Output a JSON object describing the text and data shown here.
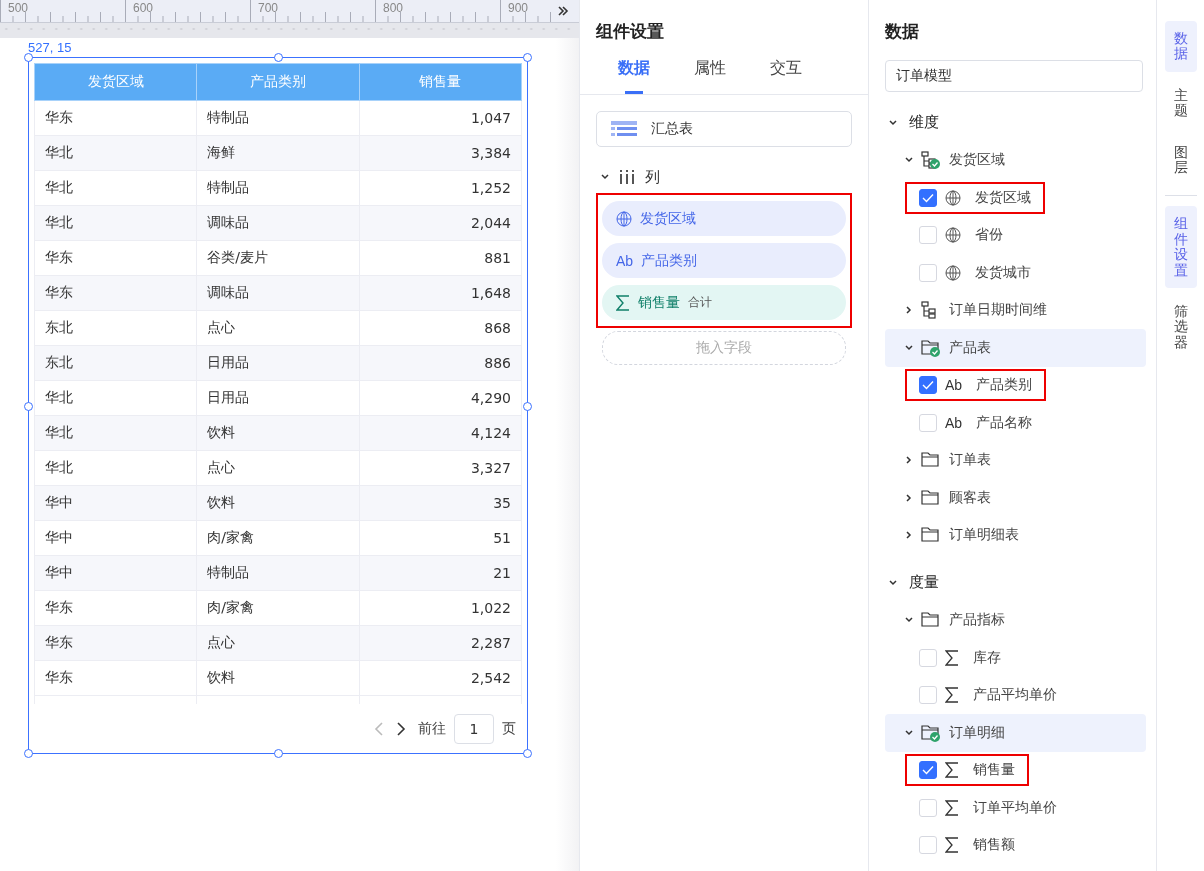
{
  "ruler": {
    "labels": [
      "500",
      "600",
      "700",
      "800",
      "900"
    ]
  },
  "canvas": {
    "coordinates": "527, 15",
    "table": {
      "columns": [
        "发货区域",
        "产品类别",
        "销售量"
      ],
      "rows": [
        [
          "华东",
          "特制品",
          "1,047"
        ],
        [
          "华北",
          "海鲜",
          "3,384"
        ],
        [
          "华北",
          "特制品",
          "1,252"
        ],
        [
          "华北",
          "调味品",
          "2,044"
        ],
        [
          "华东",
          "谷类/麦片",
          "881"
        ],
        [
          "华东",
          "调味品",
          "1,648"
        ],
        [
          "东北",
          "点心",
          "868"
        ],
        [
          "东北",
          "日用品",
          "886"
        ],
        [
          "华北",
          "日用品",
          "4,290"
        ],
        [
          "华北",
          "饮料",
          "4,124"
        ],
        [
          "华北",
          "点心",
          "3,327"
        ],
        [
          "华中",
          "饮料",
          "35"
        ],
        [
          "华中",
          "肉/家禽",
          "51"
        ],
        [
          "华中",
          "特制品",
          "21"
        ],
        [
          "华东",
          "肉/家禽",
          "1,022"
        ],
        [
          "华东",
          "点心",
          "2,287"
        ],
        [
          "华东",
          "饮料",
          "2,542"
        ]
      ]
    },
    "pagination": {
      "prev_disabled": true,
      "next_disabled": false,
      "goto_label": "前往",
      "page": "1",
      "page_suffix": "页"
    }
  },
  "settings_panel": {
    "title": "组件设置",
    "tabs": [
      {
        "label": "数据",
        "selected": true
      },
      {
        "label": "属性",
        "selected": false
      },
      {
        "label": "交互",
        "selected": false
      }
    ],
    "chart_type": "汇总表",
    "columns_section": {
      "label": "列",
      "expanded": true,
      "boxed": true,
      "fields": [
        {
          "label": "发货区域",
          "kind": "geo"
        },
        {
          "label": "产品类别",
          "kind": "text",
          "glyph": "Ab"
        },
        {
          "label": "销售量",
          "kind": "measure",
          "aggregate": "合计"
        }
      ],
      "drop_placeholder": "拖入字段"
    }
  },
  "data_panel": {
    "title": "数据",
    "model_field": {
      "value": "订单模型"
    },
    "tree": [
      {
        "label": "维度",
        "kind": "section",
        "expanded": true,
        "children": [
          {
            "label": "发货区域",
            "kind": "hierarchy",
            "linked": true,
            "expanded": true,
            "selected": false,
            "children": [
              {
                "label": "发货区域",
                "kind": "geo",
                "checked": true,
                "boxed": true
              },
              {
                "label": "省份",
                "kind": "geo",
                "checked": false,
                "boxed": false
              },
              {
                "label": "发货城市",
                "kind": "geo",
                "checked": false,
                "boxed": false
              }
            ]
          },
          {
            "label": "订单日期时间维",
            "kind": "hierarchy",
            "linked": false,
            "expanded": false,
            "selected": false
          },
          {
            "label": "产品表",
            "kind": "folder",
            "linked": true,
            "expanded": true,
            "selected": true,
            "children": [
              {
                "label": "产品类别",
                "kind": "text",
                "glyph": "Ab",
                "checked": true,
                "boxed": true
              },
              {
                "label": "产品名称",
                "kind": "text",
                "glyph": "Ab",
                "checked": false,
                "boxed": false
              }
            ]
          },
          {
            "label": "订单表",
            "kind": "folder",
            "linked": false,
            "expanded": false,
            "selected": false
          },
          {
            "label": "顾客表",
            "kind": "folder",
            "linked": false,
            "expanded": false,
            "selected": false
          },
          {
            "label": "订单明细表",
            "kind": "folder",
            "linked": false,
            "expanded": false,
            "selected": false
          }
        ]
      },
      {
        "label": "度量",
        "kind": "section",
        "expanded": true,
        "children": [
          {
            "label": "产品指标",
            "kind": "folder",
            "linked": false,
            "expanded": true,
            "selected": false,
            "children": [
              {
                "label": "库存",
                "kind": "measure",
                "checked": false,
                "boxed": false
              },
              {
                "label": "产品平均单价",
                "kind": "measure",
                "checked": false,
                "boxed": false
              }
            ]
          },
          {
            "label": "订单明细",
            "kind": "folder",
            "linked": true,
            "expanded": true,
            "selected": true,
            "children": [
              {
                "label": "销售量",
                "kind": "measure",
                "checked": true,
                "boxed": true
              },
              {
                "label": "订单平均单价",
                "kind": "measure",
                "checked": false,
                "boxed": false
              },
              {
                "label": "销售额",
                "kind": "measure",
                "checked": false,
                "boxed": false
              }
            ]
          }
        ]
      }
    ]
  },
  "side_tab_groups": [
    [
      {
        "label": "数据",
        "selected": true
      },
      {
        "label": "主题",
        "selected": false
      },
      {
        "label": "图层",
        "selected": false
      }
    ],
    [
      {
        "label": "组件设置",
        "selected": true
      },
      {
        "label": "筛选器",
        "selected": false
      }
    ]
  ]
}
